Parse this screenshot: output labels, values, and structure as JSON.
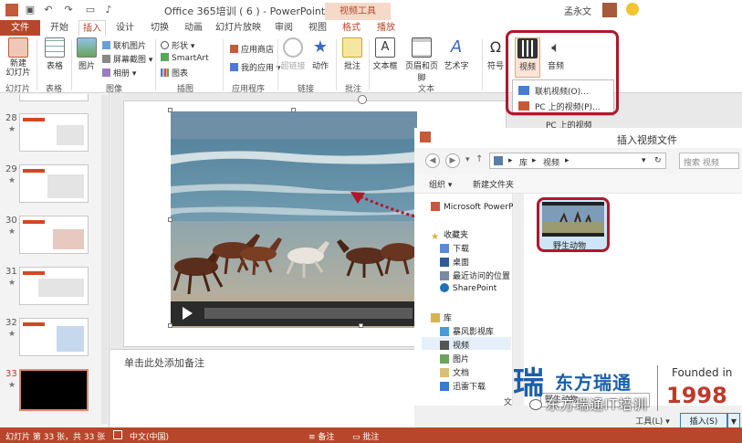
{
  "window": {
    "title": "Office 365培训 ( 6 ) - PowerPoint",
    "context_tab": "视频工具",
    "user": "孟永文"
  },
  "tabs": [
    "文件",
    "开始",
    "插入",
    "设计",
    "切换",
    "动画",
    "幻灯片放映",
    "审阅",
    "视图",
    "格式",
    "播放"
  ],
  "ribbon": {
    "new_slide": "新建\n幻灯片",
    "table": "表格",
    "picture": "图片",
    "online_picture": "联机图片",
    "screenshot": "屏幕截图",
    "album": "相册",
    "shapes": "形状",
    "smartart": "SmartArt",
    "chart": "图表",
    "app_store": "应用商店",
    "my_apps": "我的应用",
    "hyperlink": "超链接",
    "action": "动作",
    "comment": "批注",
    "textbox": "文本框",
    "header_footer": "页眉和页脚",
    "wordart": "艺术字",
    "symbol": "符号",
    "video": "视频",
    "audio": "音频",
    "groups": {
      "slides": "幻灯片",
      "tables": "表格",
      "images": "图像",
      "illustrations": "插图",
      "apps": "应用程序",
      "links": "链接",
      "comments": "批注",
      "text": "文本"
    }
  },
  "video_dropdown": {
    "online_video": "联机视频(O)...",
    "pc_video": "PC 上的视频(P)...",
    "behind_label": "PC 上的视频"
  },
  "slides": [
    {
      "num": "28",
      "star": "★"
    },
    {
      "num": "29",
      "star": "★"
    },
    {
      "num": "30",
      "star": "★"
    },
    {
      "num": "31",
      "star": "★"
    },
    {
      "num": "32",
      "star": "★"
    },
    {
      "num": "33",
      "star": "★"
    }
  ],
  "notes_placeholder": "单击此处添加备注",
  "dialog": {
    "title": "插入视频文件",
    "breadcrumb": [
      "库",
      "视频"
    ],
    "search_placeholder": "搜索 视频",
    "organize": "组织 ▾",
    "new_folder": "新建文件夹",
    "nav": [
      "Microsoft PowerP",
      "收藏夹",
      "下载",
      "桌面",
      "最近访问的位置",
      "SharePoint",
      "库",
      "暴风影视库",
      "视频",
      "图片",
      "文档",
      "迅雷下载"
    ],
    "file_name": "野生动物",
    "filename_label": "文",
    "filename_value": "野生动物",
    "tools_btn": "工具(L)",
    "insert_btn": "插入(S)"
  },
  "status": {
    "slide_info": "幻灯片 第 33 张，共 33 张",
    "lang": "中文(中国)",
    "notes": "备注",
    "comments": "批注"
  },
  "watermark": {
    "logo_char": "瑞",
    "company": "东方瑞通",
    "founded": "Founded in",
    "year": "1998",
    "handle": "东方瑞通IT培训"
  },
  "colors": {
    "accent": "#b7472a",
    "highlight_box": "#b0172a",
    "slide_bg": "#e9e9e9"
  }
}
